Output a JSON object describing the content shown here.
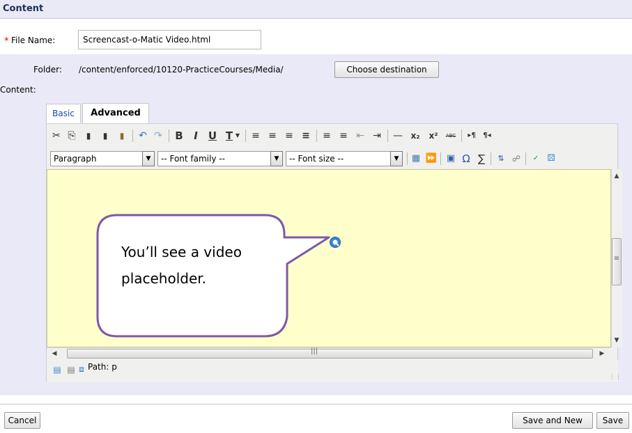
{
  "section": {
    "title": "Content"
  },
  "file": {
    "label": "File Name:",
    "value": "Screencast-o-Matic Video.html",
    "required_marker": "*"
  },
  "folder": {
    "label": "Folder:",
    "path": "/content/enforced/10120-PracticeCourses/Media/",
    "choose_button": "Choose destination"
  },
  "content": {
    "label": "Content:"
  },
  "tabs": [
    {
      "label": "Basic",
      "active": false
    },
    {
      "label": "Advanced",
      "active": true
    }
  ],
  "editor": {
    "toolbar_row1": [
      "cut-icon",
      "copy-icon",
      "paste-icon",
      "paste-text-icon",
      "paste-word-icon",
      "undo-icon",
      "redo-icon",
      "bold-icon",
      "italic-icon",
      "underline-icon",
      "text-color-icon",
      "align-left-icon",
      "align-center-icon",
      "align-right-icon",
      "align-justify-icon",
      "bullet-list-icon",
      "numbered-list-icon",
      "outdent-icon",
      "indent-icon",
      "horizontal-rule-icon",
      "subscript-icon",
      "superscript-icon",
      "strikethrough-icon",
      "ltr-icon",
      "rtl-icon"
    ],
    "block_format": "Paragraph",
    "font_family": "-- Font family --",
    "font_size": "-- Font size --",
    "glyphs": {
      "cut": "✂",
      "copy": "⎘",
      "paste": "📋",
      "undo": "↶",
      "redo": "↷",
      "bold": "B",
      "italic": "I",
      "underline": "U",
      "textcolor": "T",
      "subscript": "x₂",
      "superscript": "x²",
      "strike": "ABC",
      "ltr": "▸¶",
      "rtl": "¶◂",
      "hr": "—",
      "omega": "Ω",
      "sigma": "∑"
    },
    "path_label": "Path: p"
  },
  "callout": {
    "text_line1": "You’ll see a video",
    "text_line2": "placeholder."
  },
  "footer": {
    "cancel": "Cancel",
    "save_and_new": "Save and New",
    "save": "Save"
  },
  "colors": {
    "form_bg": "#e9e9f7",
    "editor_bg": "#ffffcc",
    "callout_border": "#7b5aa6",
    "link_blue": "#1848a8"
  }
}
